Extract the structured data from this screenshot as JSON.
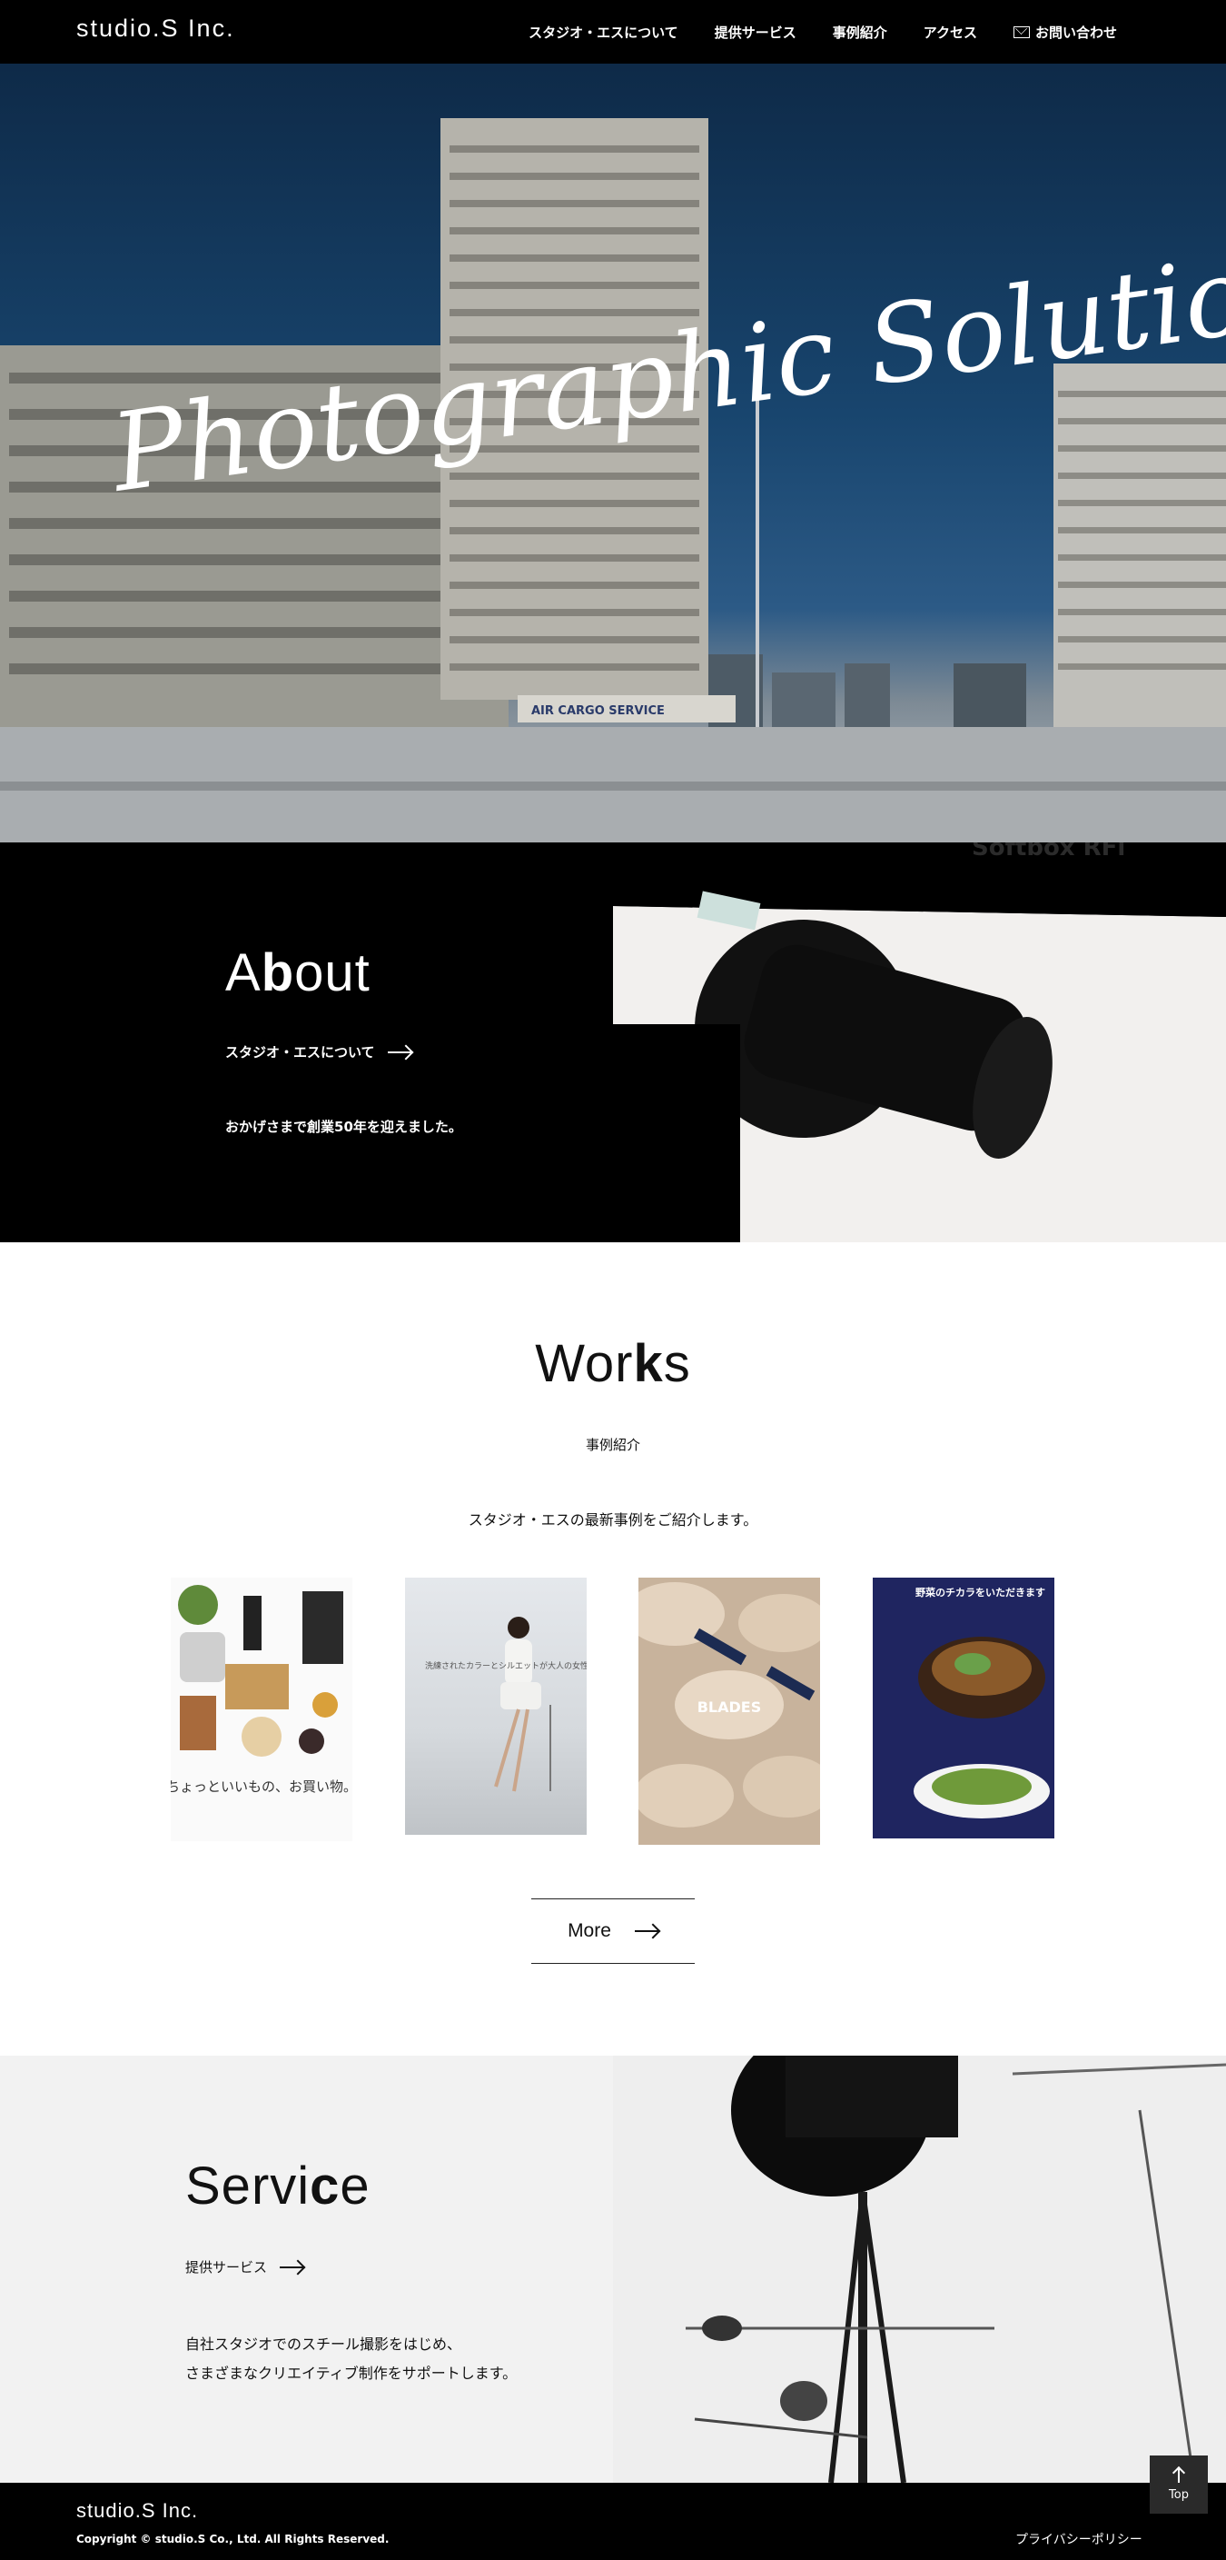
{
  "header": {
    "logo": "studio.S Inc.",
    "nav": [
      {
        "label": "スタジオ・エスについて"
      },
      {
        "label": "提供サービス"
      },
      {
        "label": "事例紹介"
      },
      {
        "label": "アクセス"
      },
      {
        "label": "お問い合わせ",
        "icon": "mail-icon"
      }
    ]
  },
  "hero": {
    "tagline": "Photographic Solution",
    "sign_text": "AIR CARGO SERVICE",
    "overlay_text": "Softbox RFi"
  },
  "about": {
    "title_pre": "A",
    "title_bold": "b",
    "title_post": "out",
    "link_label": "スタジオ・エスについて",
    "description": "おかげさまで創業50年を迎えました。"
  },
  "works": {
    "title_pre": "Wor",
    "title_bold": "k",
    "title_post": "s",
    "subtitle": "事例紹介",
    "description": "スタジオ・エスの最新事例をご紹介します。",
    "items": [
      {
        "caption": "ちょっといいもの、お買い物。"
      },
      {
        "caption": "洗練されたカラーとシルエットが大人の女性を美しく彩るストレッチパンツ"
      },
      {
        "caption": "BLADES"
      },
      {
        "caption": "野菜のチカラをいただきます"
      }
    ],
    "more_label": "More"
  },
  "service": {
    "title_pre": "Servi",
    "title_bold": "c",
    "title_post": "e",
    "link_label": "提供サービス",
    "description_line1": "自社スタジオでのスチール撮影をはじめ、",
    "description_line2": "さまざまなクリエイティブ制作をサポートします。"
  },
  "footer": {
    "logo": "studio.S Inc.",
    "copyright": "Copyright © studio.S Co., Ltd. All Rights Reserved.",
    "privacy": "プライバシーポリシー",
    "top_label": "Top"
  }
}
